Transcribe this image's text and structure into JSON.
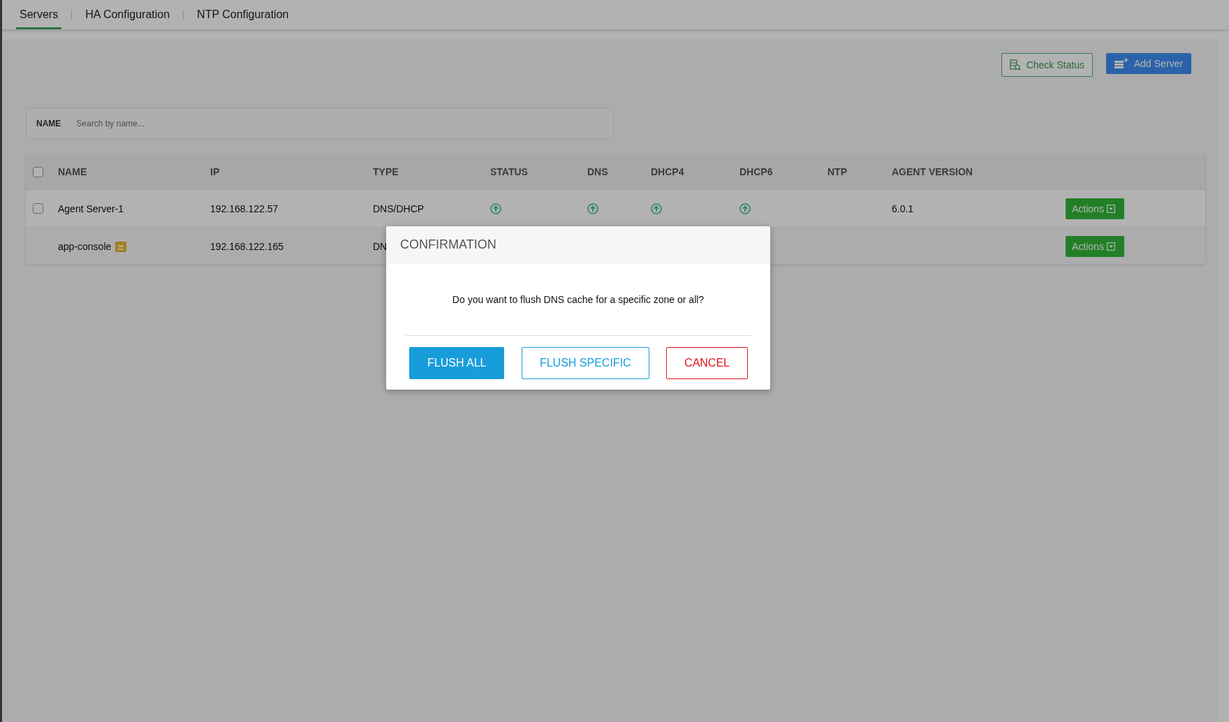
{
  "tabs": [
    {
      "label": "Servers",
      "selected": true
    },
    {
      "label": "HA Configuration",
      "selected": false
    },
    {
      "label": "NTP Configuration",
      "selected": false
    }
  ],
  "toolbar": {
    "buttons": [
      {
        "label": "Check Status",
        "kind": "outline"
      },
      {
        "label": "Add Server",
        "kind": "primary"
      }
    ]
  },
  "filter": {
    "label": "NAME",
    "placeholder": "Search by name..."
  },
  "table": {
    "select_all_checked": false,
    "columns": [
      "NAME",
      "IP",
      "TYPE",
      "STATUS",
      "DNS",
      "DHCP4",
      "DHCP6",
      "NTP",
      "AGENT VERSION"
    ],
    "rows": [
      {
        "checked": false,
        "name": "Agent Server-1",
        "ip": "192.168.122.57",
        "type": "DNS/DHCP",
        "status_up": true,
        "dns_up": true,
        "dhcp4_up": true,
        "dhcp6_up": true,
        "agent_version": "6.0.1",
        "action": "Actions"
      },
      {
        "name": "app-console",
        "badge": true,
        "ip": "192.168.122.165",
        "type": "DN",
        "action": "Actions"
      }
    ]
  },
  "dialog": {
    "title": "CONFIRMATION",
    "message": "Do you want to flush DNS cache for a specific zone or all?",
    "buttons": [
      {
        "label": "FLUSH ALL",
        "kind": "primary"
      },
      {
        "label": "FLUSH SPECIFIC",
        "kind": "outline"
      },
      {
        "label": "CANCEL",
        "kind": "danger"
      }
    ]
  }
}
